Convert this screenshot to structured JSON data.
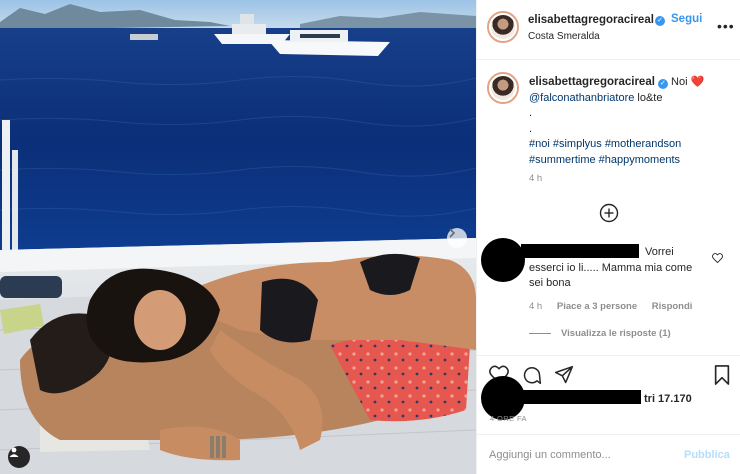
{
  "post": {
    "username": "elisabettagregoracireal",
    "follow_label": "Segui",
    "location": "Costa Smeralda",
    "more_label": "•••"
  },
  "caption": {
    "username": "elisabettagregoracireal",
    "text_after_name": "Noi",
    "heart": "❤️",
    "mention": "@falconathanbriatore",
    "mention_suffix": "lo&te",
    "dot1": ".",
    "dot2": ".",
    "hashtags_line1": "#noi #simplyus #motherandson",
    "hashtags_line2": "#summertime #happymoments",
    "time": "4 h"
  },
  "comment": {
    "text_line1": "Vorrei",
    "text_line2": "esserci io li..... Mamma mia come",
    "text_line3": "sei bona",
    "time": "4 h",
    "likes": "Piace a 3 persone",
    "reply": "Rispondi",
    "view_replies": "Visualizza le risposte (1)"
  },
  "likes": {
    "count_text": "tri 17.170"
  },
  "post_time": "4 ORE FA",
  "add_comment": {
    "placeholder": "Aggiungi un commento...",
    "publish": "Pubblica"
  },
  "colors": {
    "accent": "#3897f0",
    "publish_disabled": "#b2dffc",
    "sea": "#0d3a8c",
    "heart": "#ed4956"
  },
  "icons": [
    "verified-badge-icon",
    "more-options-icon",
    "plus-circle-icon",
    "heart-icon",
    "comment-icon",
    "share-icon",
    "bookmark-icon",
    "next-arrow-icon",
    "user-tag-icon"
  ]
}
